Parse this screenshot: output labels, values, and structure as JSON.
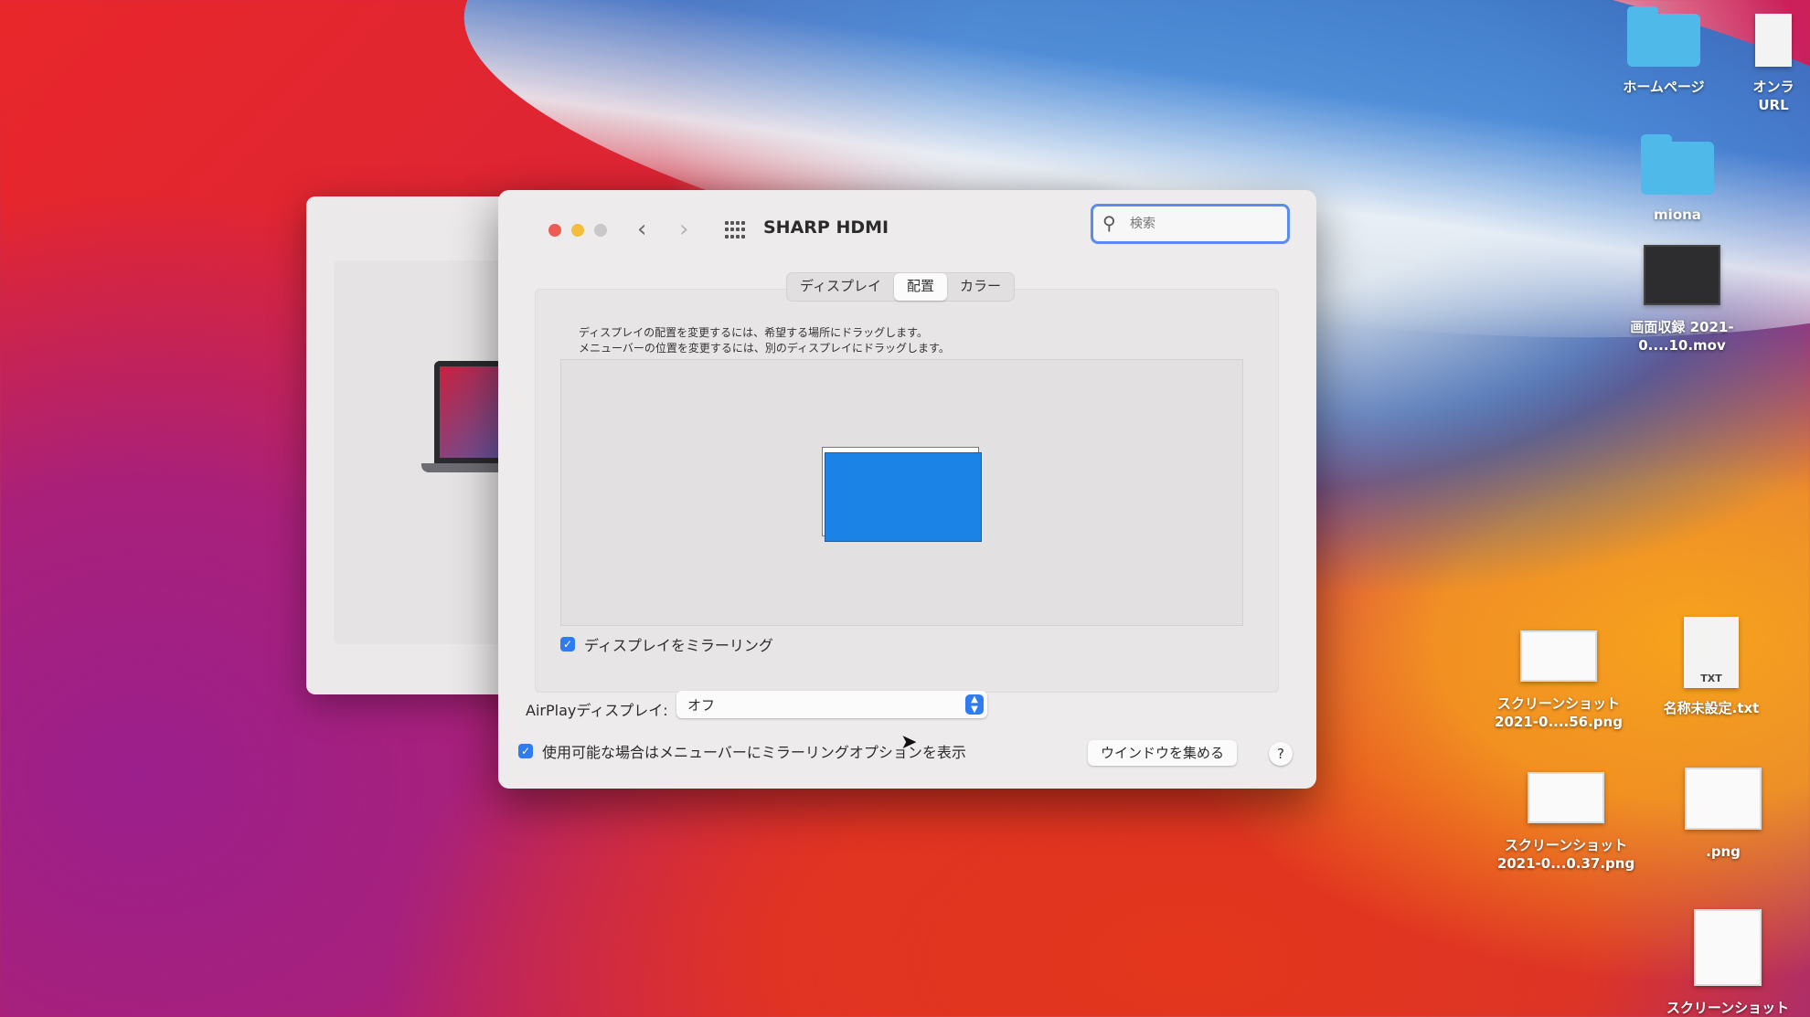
{
  "window": {
    "title": "SHARP HDMI",
    "search_placeholder": "検索",
    "tabs": [
      {
        "label": "ディスプレイ",
        "active": false
      },
      {
        "label": "配置",
        "active": true
      },
      {
        "label": "カラー",
        "active": false
      }
    ],
    "instructions": [
      "ディスプレイの配置を変更するには、希望する場所にドラッグします。",
      "メニューバーの位置を変更するには、別のディスプレイにドラッグします。"
    ],
    "mirror_label": "ディスプレイをミラーリング",
    "mirror_checked": true,
    "airplay_label": "AirPlayディスプレイ:",
    "airplay_value": "オフ",
    "menubar_option_label": "使用可能な場合はメニューバーにミラーリングオプションを表示",
    "menubar_option_checked": true,
    "gather_windows_label": "ウインドウを集める",
    "help_label": "?"
  },
  "desktop": {
    "items": [
      {
        "label": "ホームページ",
        "kind": "folder-icon"
      },
      {
        "label": "オンラ URL",
        "kind": "document-icon"
      },
      {
        "label": "miona",
        "kind": "folder-icon"
      },
      {
        "label": "画面収録 2021-0....10.mov",
        "kind": "video-thumbnail"
      },
      {
        "label": "スクリーンショット 2021-0....56.png",
        "kind": "image-thumbnail"
      },
      {
        "label": "名称未設定.txt",
        "kind": "text-file-icon"
      },
      {
        "label": "スクリーンショット 2021-0...0.37.png",
        "kind": "image-thumbnail"
      },
      {
        "label": ".png",
        "kind": "image-thumbnail"
      },
      {
        "label": "スクリーンショット",
        "kind": "image-thumbnail"
      }
    ],
    "txt_badge": "TXT"
  },
  "colors": {
    "accent": "#2f7bf0",
    "display_blue": "#1b82e6"
  }
}
